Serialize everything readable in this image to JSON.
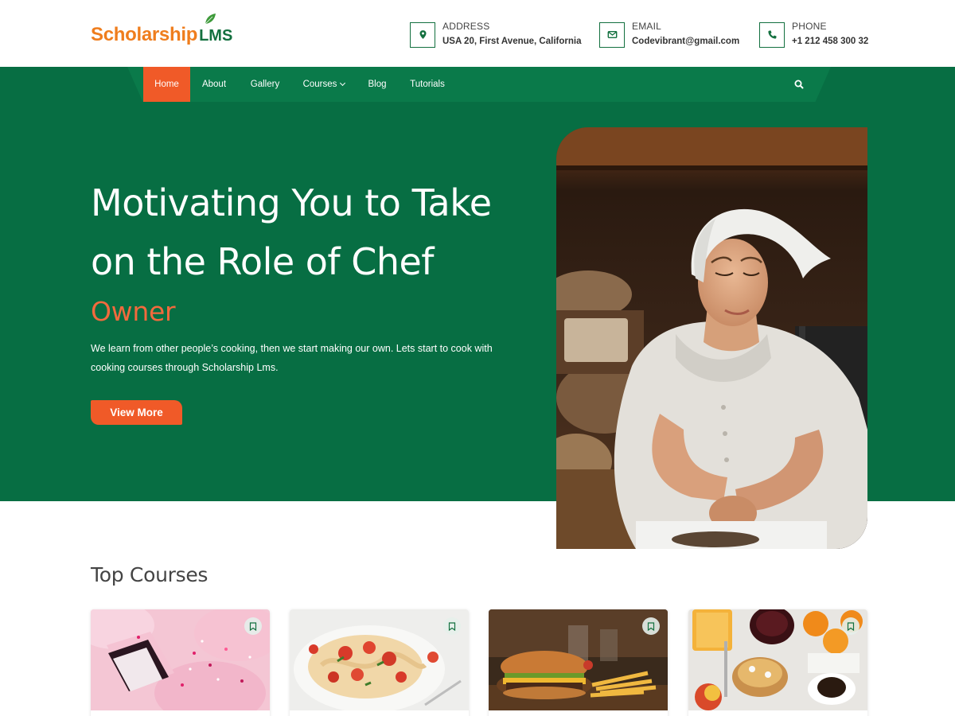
{
  "brand": {
    "name_part1": "Scholarship",
    "name_part2": "LMS",
    "colors": {
      "orange": "#ef7d1d",
      "green": "#13703f",
      "hero_bg": "#076e43",
      "accent": "#f05a28"
    }
  },
  "contacts": [
    {
      "icon": "map-pin-icon",
      "label": "ADDRESS",
      "value": "USA 20, First Avenue, California"
    },
    {
      "icon": "envelope-icon",
      "label": "EMAIL",
      "value": "Codevibrant@gmail.com"
    },
    {
      "icon": "phone-icon",
      "label": "PHONE",
      "value": "+1 212 458 300 32"
    }
  ],
  "nav": {
    "items": [
      {
        "label": "Home",
        "active": true
      },
      {
        "label": "About"
      },
      {
        "label": "Gallery"
      },
      {
        "label": "Courses",
        "has_dropdown": true
      },
      {
        "label": "Blog"
      },
      {
        "label": "Tutorials"
      }
    ],
    "search_icon": "search-icon"
  },
  "hero": {
    "title_line1": "Motivating You to Take",
    "title_line2": "on the Role of Chef",
    "subtitle": "Owner",
    "description_line1": "We learn from other people’s cooking, then we start making our own. Lets start to cook with",
    "description_line2": "cooking courses through Scholarship Lms.",
    "button_label": "View More",
    "image": "chef-woman-photo"
  },
  "courses": {
    "section_title": "Top Courses",
    "cards": [
      {
        "image": "pink-macarons-photo",
        "icon": "bookmark-icon"
      },
      {
        "image": "pasta-dish-photo",
        "icon": "bookmark-icon"
      },
      {
        "image": "burger-fries-photo",
        "icon": "bookmark-icon"
      },
      {
        "image": "breakfast-table-photo",
        "icon": "bookmark-icon"
      }
    ]
  }
}
